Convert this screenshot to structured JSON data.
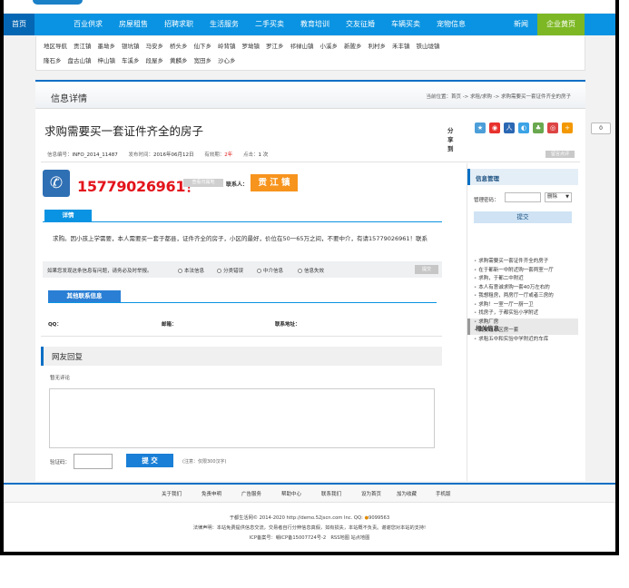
{
  "nav": {
    "items": [
      "首页",
      "百业供求",
      "房屋租售",
      "招聘求职",
      "生活服务",
      "二手买卖",
      "教育培训",
      "交友征婚",
      "车辆买卖",
      "宠物信息",
      "新闻",
      "企业黄页"
    ]
  },
  "areas": {
    "row1": [
      "地区导航",
      "贡江镇",
      "墨坳乡",
      "银坑镇",
      "马安乡",
      "桥头乡",
      "仙下乡",
      "岭背镇",
      "罗坳镇",
      "罗江乡",
      "祁禄山镇",
      "小溪乡",
      "新陂乡",
      "利村乡",
      "禾丰镇",
      "铁山垅镇"
    ],
    "row2": [
      "隆石乡",
      "盘古山镇",
      "梓山镇",
      "车溪乡",
      "段屋乡",
      "黄麟乡",
      "宽田乡",
      "沙心乡"
    ]
  },
  "section": {
    "title": "信息详情",
    "breadcrumb": "当前位置：首页 -> 求租/求购 -> 求购需要买一套证件齐全的房子"
  },
  "post": {
    "title": "求购需要买一套证件齐全的房子",
    "share_label": "分享到",
    "share_count": "0",
    "id_label": "信息编号：",
    "id": "INFO_2014_11487",
    "time_label": "发布时间：",
    "time": "2016年06月12日",
    "expire_label": "有效期：",
    "expire": "2年",
    "hits_label": "点击：",
    "hits": "1 次",
    "report_btn": "留言点评",
    "phone": "15779026961！",
    "qq_btn": "查看归属地",
    "contact_label": "联系人：",
    "contact": "贡 江 镇",
    "detail_tab": "详情",
    "description": "求购。因小孩上学需要，本人需要买一套于都县，证件齐全的房子，小区的最好，价位在50一65万之间，不要中介，有请15779026961！联系",
    "report_question": "如果您发现这条信息有问题，请务必及时举报。",
    "report_options": [
      "本法信息",
      "分类错误",
      "中介信息",
      "信息失效"
    ],
    "report_submit": "提交",
    "other_tab": "其他联系信息",
    "qq_label": "QQ：",
    "email_label": "邮箱：",
    "address_label": "联系地址："
  },
  "reply": {
    "title": "网友回复",
    "no_comment": "暂无评论",
    "captcha_label": "验证码：",
    "submit": "提 交",
    "note": "(注意：仅限300汉字)"
  },
  "sidebar": {
    "manage_title": "信息管理",
    "password_label": "管理密码：",
    "select_value": "删除",
    "submit": "提交",
    "related_title": "相关信息",
    "related": [
      "求购需要买一套证件齐全的房子",
      "在于都新一中附近购一套两室一厅",
      "求购，于都二中附近",
      "本人有意诚求购一套40万左右的",
      "我想租房，两房厅一厅或者三房的",
      "求购！一室一厅一厨一卫",
      "找房子，于都实验小学附近",
      "求购厂房",
      "我要租小区房一套",
      "求租五中和实验中学附近的车库"
    ]
  },
  "footer": {
    "links": [
      "关于我们",
      "免责申明",
      "广告服务",
      "帮助中心",
      "联系我们",
      "设为首页",
      "加为收藏",
      "手机版"
    ],
    "copyright": "于都生活网© 2014-2020 http://demo.52jscn.com Inc. QQ: ",
    "qq": "9099563",
    "disclaimer": "法律声明：本站免费提供信息交流，交易者自行分辨信息真假，如有损失，本站概不负责。谢谢您对本站的支持!",
    "icp": "ICP备案号：赣ICP备15007724号-2　RSS地图 站点地图"
  }
}
